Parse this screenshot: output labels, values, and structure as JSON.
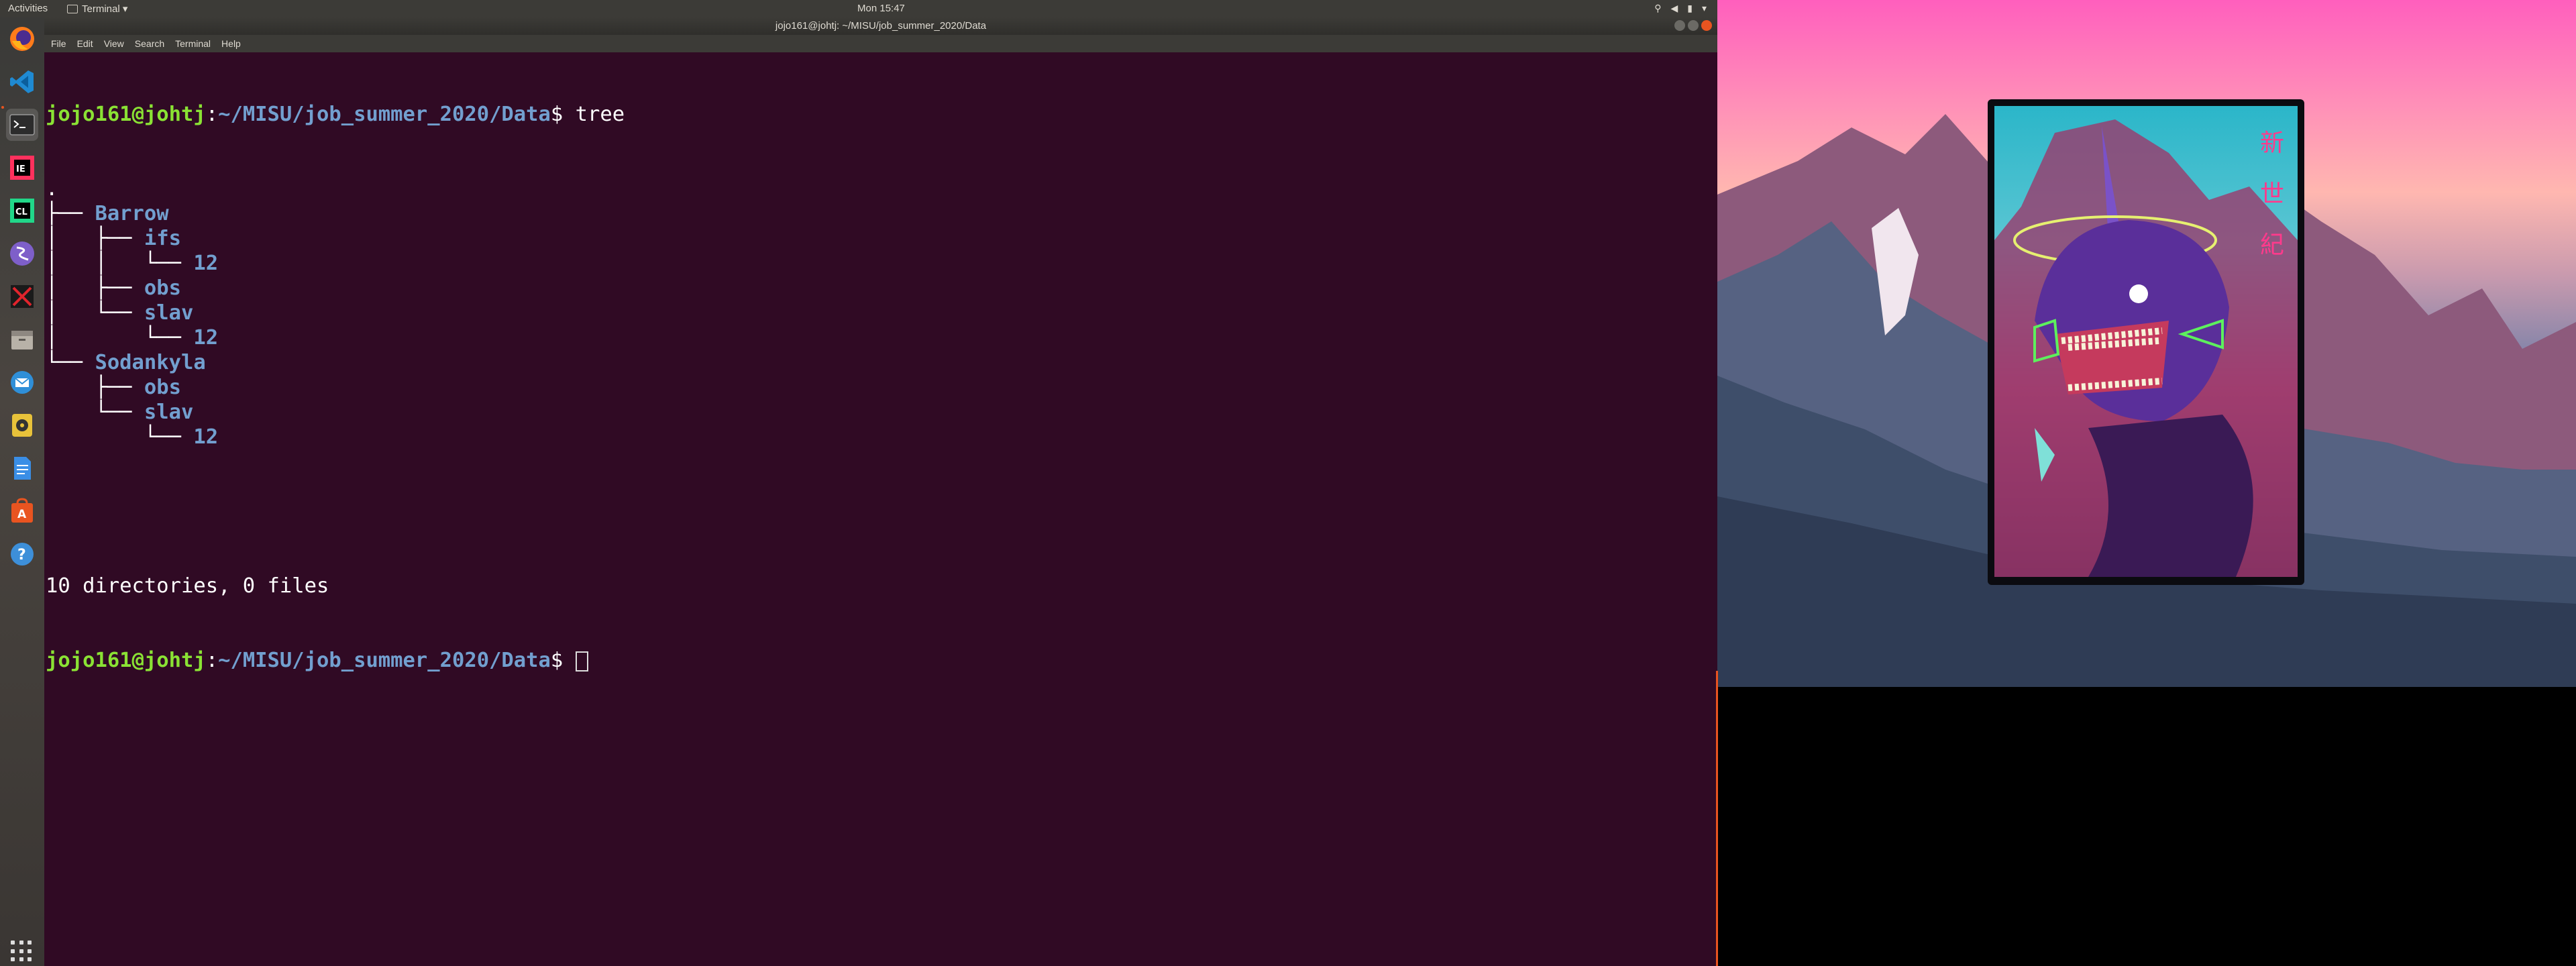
{
  "topbar": {
    "activities": "Activities",
    "app_menu": "Terminal ▾",
    "clock": "Mon 15:47"
  },
  "window": {
    "title": "jojo161@johtj: ~/MISU/job_summer_2020/Data",
    "menu": [
      "File",
      "Edit",
      "View",
      "Search",
      "Terminal",
      "Help"
    ]
  },
  "terminal": {
    "prompt_user": "jojo161@johtj",
    "prompt_sep": ":",
    "prompt_path": "~/MISU/job_summer_2020/Data",
    "prompt_end": "$ ",
    "command": "tree",
    "tree": [
      {
        "prefix": "",
        "name": ".",
        "dir": false
      },
      {
        "prefix": "├── ",
        "name": "Barrow",
        "dir": true
      },
      {
        "prefix": "│   ├── ",
        "name": "ifs",
        "dir": true
      },
      {
        "prefix": "│   │   └── ",
        "name": "12",
        "dir": true
      },
      {
        "prefix": "│   ├── ",
        "name": "obs",
        "dir": true
      },
      {
        "prefix": "│   └── ",
        "name": "slav",
        "dir": true
      },
      {
        "prefix": "│       └── ",
        "name": "12",
        "dir": true
      },
      {
        "prefix": "└── ",
        "name": "Sodankyla",
        "dir": true
      },
      {
        "prefix": "    ├── ",
        "name": "obs",
        "dir": true
      },
      {
        "prefix": "    └── ",
        "name": "slav",
        "dir": true
      },
      {
        "prefix": "        └── ",
        "name": "12",
        "dir": true
      }
    ],
    "summary": "10 directories, 0 files"
  },
  "dock": {
    "items": [
      "firefox-icon",
      "vscode-icon",
      "terminal-icon",
      "intellij-icon",
      "clion-icon",
      "emacs-icon",
      "x-app-icon",
      "files-icon",
      "thunderbird-icon",
      "rhythmbox-icon",
      "document-icon",
      "software-center-icon",
      "help-icon"
    ]
  },
  "wallpaper": {
    "kanji": [
      "新",
      "世",
      "紀"
    ]
  },
  "colors": {
    "terminal_bg": "#300a24",
    "prompt_user": "#8ae234",
    "prompt_path": "#729fcf",
    "accent": "#e95420"
  }
}
